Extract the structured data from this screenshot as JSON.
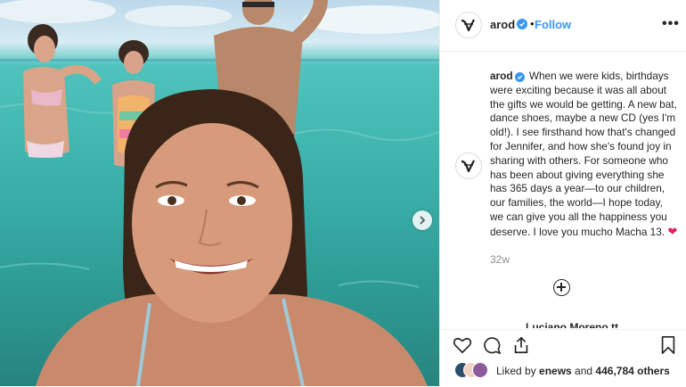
{
  "post": {
    "username": "arod",
    "follow_label": "Follow",
    "more_label": "•••",
    "separator": "•"
  },
  "caption": {
    "username": "arod",
    "text": "When we were kids, birthdays were exciting because it was all about the gifts we would be getting. A new bat, dance shoes, maybe a new CD (yes I'm old!). I see firsthand how that's changed for Jennifer, and how she's found joy in sharing with others. For someone who has been about giving everything she has 365 days a year—to our children, our families, the world—I hope today, we can give you all the happiness you deserve. I love you mucho Macha 13. ",
    "emoji": "❤",
    "time_ago": "32w"
  },
  "partial_comment": {
    "text": "Luciano Moreno tt"
  },
  "likes": {
    "prefix": "Liked by ",
    "user": "enews",
    "and": " and ",
    "others": "446,784 others"
  },
  "icons": {
    "heart": "heart-icon",
    "comment": "comment-icon",
    "share": "share-icon",
    "save": "bookmark-icon",
    "next": "chevron-right-icon",
    "add": "plus-circle-icon"
  },
  "colors": {
    "accent": "#3897f0",
    "heart_emoji": "#e0245e",
    "secondary_text": "#8e8e8e"
  }
}
